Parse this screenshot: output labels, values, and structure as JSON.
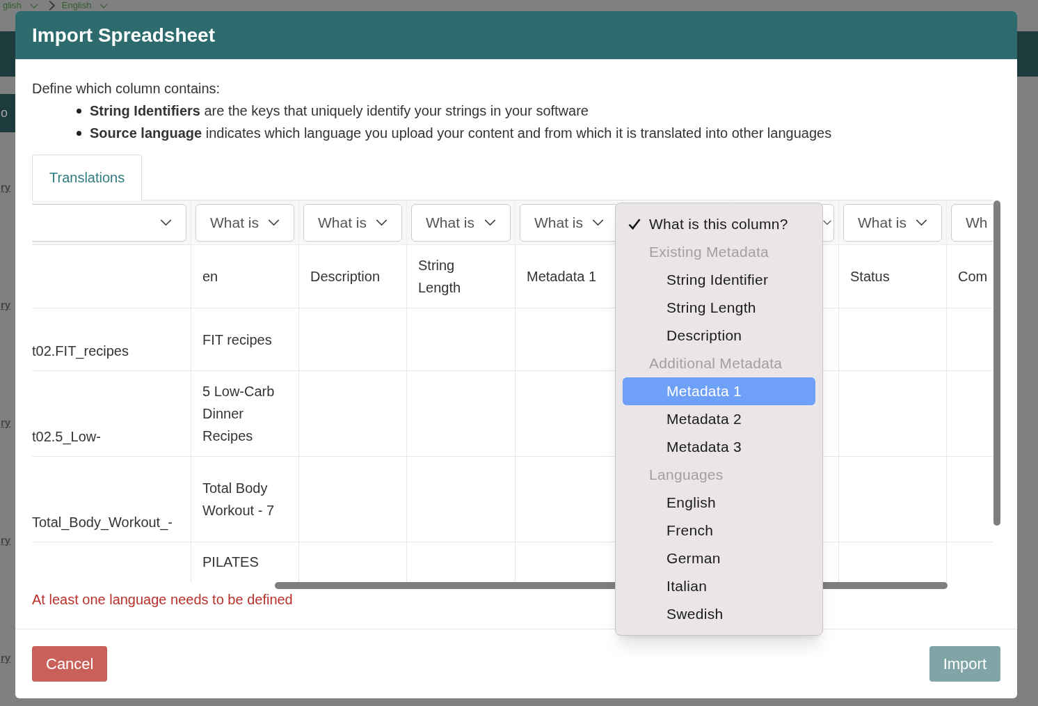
{
  "background": {
    "breadcrumb": [
      "glish",
      "English"
    ],
    "sidebar_label": "o",
    "row_labels": [
      "ry",
      "ry",
      "ry",
      "ry",
      "ry"
    ]
  },
  "dialog": {
    "title": "Import Spreadsheet",
    "intro": "Define which column contains:",
    "bullets": [
      "**String Identifiers** are the keys that uniquely identify your strings in your software",
      "**Source language** indicates which language you upload your content and from which it is translated into other languages"
    ],
    "tabs": [
      {
        "label": "Translations",
        "selected": true
      }
    ],
    "table": {
      "columns": [
        {},
        {
          "select": "What is",
          "header": "en"
        },
        {
          "select": "What is",
          "header": "Description"
        },
        {
          "select": "What is",
          "header": "String Length"
        },
        {
          "select": "What is",
          "header": "Metadata 1"
        },
        {},
        {},
        {
          "select": "What is",
          "header": "Status"
        },
        {
          "select": "Wh",
          "header": "Com"
        }
      ],
      "rows": [
        {
          "cells": [
            "t02.FIT_recipes",
            "FIT recipes"
          ]
        },
        {
          "cells": [
            "t02.5_Low-",
            "5 Low-Carb Dinner Recipes"
          ]
        },
        {
          "cells": [
            "Total_Body_Workout_-",
            "Total Body Workout - 7"
          ]
        },
        {
          "cells": [
            "",
            "PILATES"
          ]
        }
      ]
    },
    "column_menu": {
      "items": [
        {
          "kind": "option",
          "label": "What is this column?",
          "checked": true,
          "selected": false
        },
        {
          "kind": "group",
          "label": "Existing Metadata"
        },
        {
          "kind": "option",
          "label": "String Identifier",
          "checked": false,
          "selected": false
        },
        {
          "kind": "option",
          "label": "String Length",
          "checked": false,
          "selected": false
        },
        {
          "kind": "option",
          "label": "Description",
          "checked": false,
          "selected": false
        },
        {
          "kind": "group",
          "label": "Additional Metadata"
        },
        {
          "kind": "option",
          "label": "Metadata 1",
          "checked": false,
          "selected": true
        },
        {
          "kind": "option",
          "label": "Metadata 2",
          "checked": false,
          "selected": false
        },
        {
          "kind": "option",
          "label": "Metadata 3",
          "checked": false,
          "selected": false
        },
        {
          "kind": "group",
          "label": "Languages"
        },
        {
          "kind": "option",
          "label": "English",
          "checked": false,
          "selected": false
        },
        {
          "kind": "option",
          "label": "French",
          "checked": false,
          "selected": false
        },
        {
          "kind": "option",
          "label": "German",
          "checked": false,
          "selected": false
        },
        {
          "kind": "option",
          "label": "Italian",
          "checked": false,
          "selected": false
        },
        {
          "kind": "option",
          "label": "Swedish",
          "checked": false,
          "selected": false
        }
      ]
    },
    "error": "At least one language needs to be defined",
    "buttons": [
      {
        "kind": "cancel",
        "label": "Cancel",
        "disabled": false
      },
      {
        "kind": "primary",
        "label": "Import",
        "disabled": true
      }
    ]
  }
}
